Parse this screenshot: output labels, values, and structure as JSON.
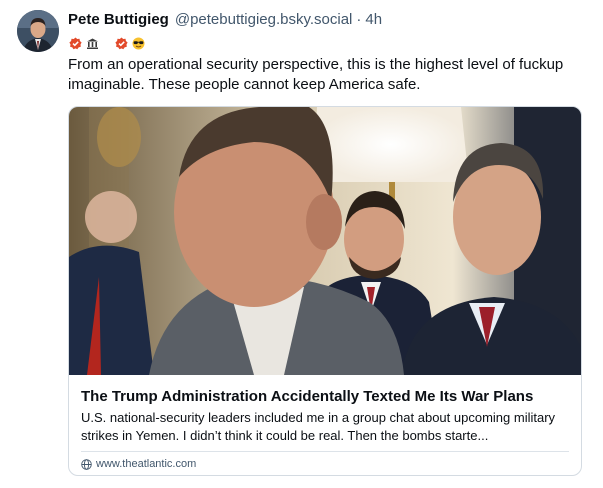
{
  "post": {
    "author": {
      "display_name": "Pete Buttigieg",
      "handle": "@petebuttigieg.bsky.social",
      "separator": "·",
      "time": "4h"
    },
    "badges": [
      "verified-check-icon",
      "bank-icon",
      "verified-check-icon",
      "sunglasses-emoji-icon"
    ],
    "text": "From an operational security perspective, this is the highest level of fuckup imaginable. These people cannot keep America safe.",
    "link_card": {
      "title": "The Trump Administration Accidentally Texted Me Its War Plans",
      "description": "U.S. national-security leaders included me in a group chat about upcoming military strikes in Yemen. I didn’t think it could be real. Then the bombs starte...",
      "domain": "www.theatlantic.com",
      "image_icon": "news-photo"
    }
  },
  "colors": {
    "text": "#0b0f14",
    "muted": "#42576c",
    "border": "#d4dbe2",
    "badge_red": "#e24a2b"
  }
}
